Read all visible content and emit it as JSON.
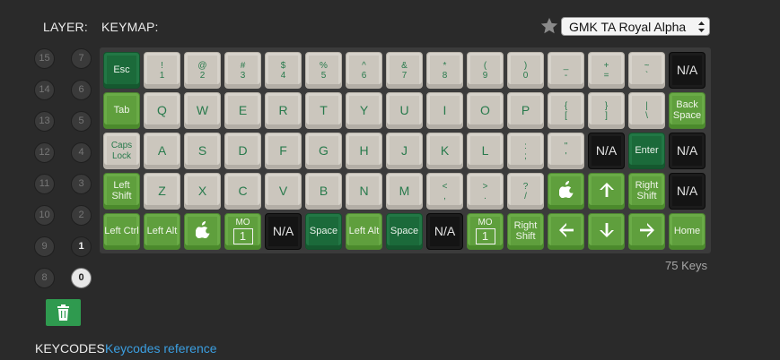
{
  "header": {
    "layer_label": "LAYER:",
    "keymap_label": "KEYMAP:"
  },
  "favorite_icon": "star-icon",
  "keyset_select": {
    "value": "GMK TA Royal Alpha"
  },
  "layers": {
    "left_column": [
      "15",
      "14",
      "13",
      "12",
      "11",
      "10",
      "9",
      "8"
    ],
    "right_column": [
      "7",
      "6",
      "5",
      "4",
      "3",
      "2",
      "1",
      "0"
    ],
    "selected": "0"
  },
  "delete_icon": "trash-icon",
  "rows": [
    [
      {
        "style": "dark",
        "label": "Esc"
      },
      {
        "style": "beige",
        "top": "!",
        "bottom": "1"
      },
      {
        "style": "beige",
        "top": "@",
        "bottom": "2"
      },
      {
        "style": "beige",
        "top": "#",
        "bottom": "3"
      },
      {
        "style": "beige",
        "top": "$",
        "bottom": "4"
      },
      {
        "style": "beige",
        "top": "%",
        "bottom": "5"
      },
      {
        "style": "beige",
        "top": "^",
        "bottom": "6"
      },
      {
        "style": "beige",
        "top": "&",
        "bottom": "7"
      },
      {
        "style": "beige",
        "top": "*",
        "bottom": "8"
      },
      {
        "style": "beige",
        "top": "(",
        "bottom": "9"
      },
      {
        "style": "beige",
        "top": ")",
        "bottom": "0"
      },
      {
        "style": "beige",
        "top": "_",
        "bottom": "-"
      },
      {
        "style": "beige",
        "top": "+",
        "bottom": "="
      },
      {
        "style": "beige",
        "top": "~",
        "bottom": "`"
      },
      {
        "style": "black",
        "label": "N/A"
      }
    ],
    [
      {
        "style": "light",
        "label": "Tab"
      },
      {
        "style": "beige",
        "label": "Q"
      },
      {
        "style": "beige",
        "label": "W"
      },
      {
        "style": "beige",
        "label": "E"
      },
      {
        "style": "beige",
        "label": "R"
      },
      {
        "style": "beige",
        "label": "T"
      },
      {
        "style": "beige",
        "label": "Y"
      },
      {
        "style": "beige",
        "label": "U"
      },
      {
        "style": "beige",
        "label": "I"
      },
      {
        "style": "beige",
        "label": "O"
      },
      {
        "style": "beige",
        "label": "P"
      },
      {
        "style": "beige",
        "top": "{",
        "bottom": "["
      },
      {
        "style": "beige",
        "top": "}",
        "bottom": "]"
      },
      {
        "style": "beige",
        "top": "|",
        "bottom": "\\"
      },
      {
        "style": "light",
        "label": "Back Space"
      }
    ],
    [
      {
        "style": "beige",
        "label": "Caps Lock",
        "small": true
      },
      {
        "style": "beige",
        "label": "A"
      },
      {
        "style": "beige",
        "label": "S"
      },
      {
        "style": "beige",
        "label": "D"
      },
      {
        "style": "beige",
        "label": "F"
      },
      {
        "style": "beige",
        "label": "G"
      },
      {
        "style": "beige",
        "label": "H"
      },
      {
        "style": "beige",
        "label": "J"
      },
      {
        "style": "beige",
        "label": "K"
      },
      {
        "style": "beige",
        "label": "L"
      },
      {
        "style": "beige",
        "top": ":",
        "bottom": ";"
      },
      {
        "style": "beige",
        "top": "\"",
        "bottom": "'"
      },
      {
        "style": "black",
        "label": "N/A"
      },
      {
        "style": "dark",
        "label": "Enter"
      },
      {
        "style": "black",
        "label": "N/A"
      }
    ],
    [
      {
        "style": "light",
        "label": "Left Shift"
      },
      {
        "style": "beige",
        "label": "Z"
      },
      {
        "style": "beige",
        "label": "X"
      },
      {
        "style": "beige",
        "label": "C"
      },
      {
        "style": "beige",
        "label": "V"
      },
      {
        "style": "beige",
        "label": "B"
      },
      {
        "style": "beige",
        "label": "N"
      },
      {
        "style": "beige",
        "label": "M"
      },
      {
        "style": "beige",
        "top": "<",
        "bottom": ","
      },
      {
        "style": "beige",
        "top": ">",
        "bottom": "."
      },
      {
        "style": "beige",
        "top": "?",
        "bottom": "/"
      },
      {
        "style": "light",
        "icon": "apple-icon"
      },
      {
        "style": "light",
        "icon": "arrow-up-icon"
      },
      {
        "style": "light",
        "label": "Right Shift"
      },
      {
        "style": "black",
        "label": "N/A"
      }
    ],
    [
      {
        "style": "light",
        "label": "Left Ctrl"
      },
      {
        "style": "light",
        "label": "Left Alt"
      },
      {
        "style": "light",
        "icon": "apple-icon"
      },
      {
        "style": "light",
        "mo": "MO",
        "layer": "1"
      },
      {
        "style": "black",
        "label": "N/A"
      },
      {
        "style": "dark",
        "label": "Space"
      },
      {
        "style": "light",
        "label": "Left Alt"
      },
      {
        "style": "dark",
        "label": "Space"
      },
      {
        "style": "black",
        "label": "N/A"
      },
      {
        "style": "light",
        "mo": "MO",
        "layer": "1"
      },
      {
        "style": "light",
        "label": "Right Shift"
      },
      {
        "style": "light",
        "icon": "arrow-left-icon"
      },
      {
        "style": "light",
        "icon": "arrow-down-icon"
      },
      {
        "style": "light",
        "icon": "arrow-right-icon"
      },
      {
        "style": "light",
        "label": "Home"
      }
    ]
  ],
  "key_count": "75 Keys",
  "footer": {
    "keycodes_label": "KEYCODES:",
    "keycodes_link": "Keycodes reference"
  }
}
